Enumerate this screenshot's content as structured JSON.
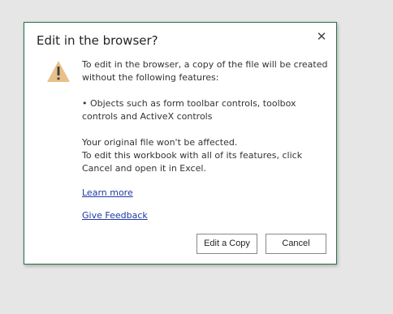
{
  "dialog": {
    "title": "Edit in the browser?",
    "close_label": "✕",
    "message_intro": "To edit in the browser, a copy of the file will be created without the following features:",
    "feature_item": "• Objects such as form toolbar controls, toolbox controls and ActiveX controls",
    "original_note": "Your original file won't be affected.",
    "full_features_note": "To edit this workbook with all of its features, click Cancel and open it in Excel.",
    "learn_more": "Learn more",
    "give_feedback": "Give Feedback",
    "edit_copy_button": "Edit a Copy",
    "cancel_button": "Cancel",
    "icon": "warning-icon",
    "colors": {
      "border": "#217346",
      "warning": "#e8c08a",
      "link": "#1f3aa4"
    }
  }
}
